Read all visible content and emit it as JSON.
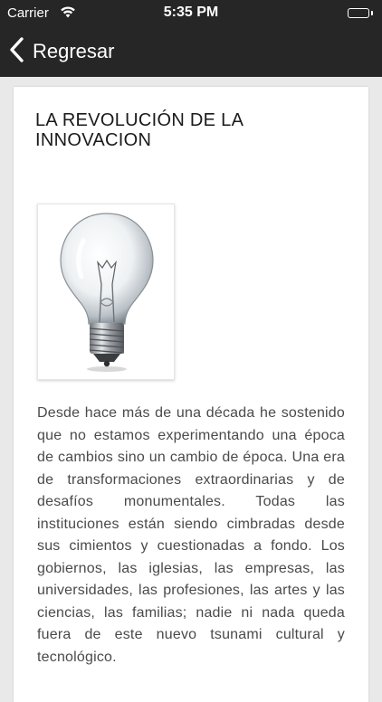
{
  "status_bar": {
    "carrier": "Carrier",
    "time": "5:35 PM",
    "wifi_icon": "wifi-icon",
    "battery_icon": "battery-icon",
    "background": "#262626"
  },
  "nav": {
    "back_label": "Regresar",
    "back_icon": "chevron-left-icon",
    "background": "#262626"
  },
  "article": {
    "title": "LA REVOLUCIÓN DE LA INNOVACION",
    "image_icon": "light-bulb-image",
    "body": "Desde hace más de una década he sostenido que no estamos experimentando una época de cambios sino un cambio de época. Una era de transformaciones extraordinarias y de desafíos monumentales. Todas las instituciones están siendo cimbradas desde sus cimientos y cuestionadas a fondo. Los gobiernos, las iglesias, las empresas, las universidades, las profesiones, las artes y las ciencias, las familias; nadie ni nada queda fuera de este nuevo tsunami cultural y tecnológico."
  }
}
